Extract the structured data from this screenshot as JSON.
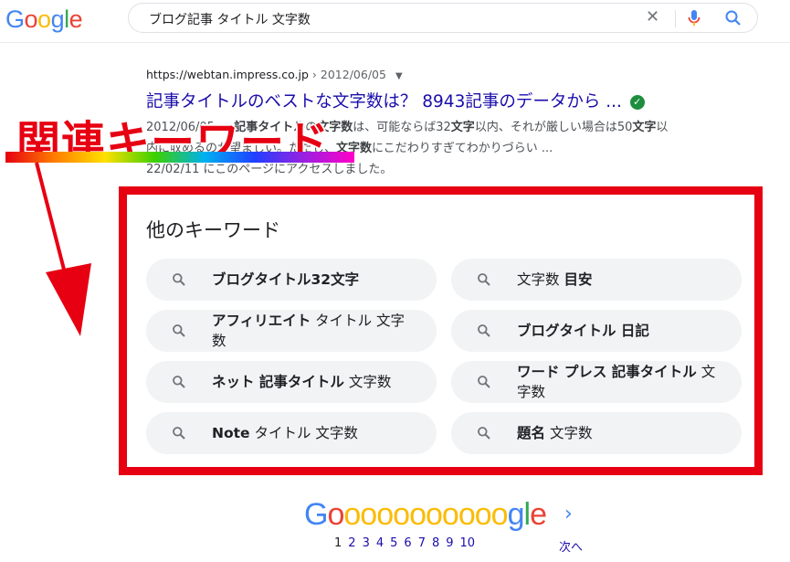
{
  "header": {
    "logo": [
      "G",
      "o",
      "o",
      "g",
      "l",
      "e"
    ],
    "query": "ブログ記事 タイトル 文字数",
    "clear_icon": "close-icon",
    "mic_icon": "mic-icon",
    "search_icon": "search-icon"
  },
  "result": {
    "url": "https://webtan.impress.co.jp",
    "date": "› 2012/06/05",
    "title": "記事タイトルのベストな文字数は？ 8943記事のデータから ...",
    "snippet": [
      {
        "parts": [
          {
            "t": "2012/06/05 — ",
            "b": false
          },
          {
            "t": "記事タイトル",
            "b": true
          },
          {
            "t": "の",
            "b": false
          },
          {
            "t": "文字数",
            "b": true
          },
          {
            "t": "は、可能ならば32",
            "b": false
          },
          {
            "t": "文字",
            "b": true
          },
          {
            "t": "以内、それが厳しい場合は50",
            "b": false
          },
          {
            "t": "文字",
            "b": true
          },
          {
            "t": "以",
            "b": false
          }
        ]
      },
      {
        "parts": [
          {
            "t": "内に収めるのが望ましい。ただし、",
            "b": false
          },
          {
            "t": "文字数",
            "b": true
          },
          {
            "t": "にこだわりすぎてわかりづらい ...",
            "b": false
          }
        ]
      },
      {
        "parts": [
          {
            "t": "22/02/11 にこのページにアクセスしました。",
            "b": false
          }
        ]
      }
    ]
  },
  "annotation": {
    "label": "関連キーワード",
    "colors": {
      "red": "#e60012"
    }
  },
  "related": {
    "heading": "他のキーワード",
    "items": [
      {
        "parts": [
          {
            "t": "ブログタイトル32文字",
            "b": true
          }
        ],
        "two": false
      },
      {
        "parts": [
          {
            "t": "文字数 ",
            "b": false
          },
          {
            "t": "目安",
            "b": true
          }
        ],
        "two": false
      },
      {
        "parts": [
          {
            "t": "アフィリエイト",
            "b": true
          },
          {
            "t": " タイトル 文字数",
            "b": false
          }
        ],
        "two": true
      },
      {
        "parts": [
          {
            "t": "ブログタイトル 日記",
            "b": true
          }
        ],
        "two": false
      },
      {
        "parts": [
          {
            "t": "ネット 記事タイトル",
            "b": true
          },
          {
            "t": " 文字数",
            "b": false
          }
        ],
        "two": false
      },
      {
        "parts": [
          {
            "t": "ワード プレス 記事タイトル",
            "b": true
          },
          {
            "t": " 文字数",
            "b": false
          }
        ],
        "two": true
      },
      {
        "parts": [
          {
            "t": "Note",
            "b": true
          },
          {
            "t": " タイトル 文字数",
            "b": false
          }
        ],
        "two": false
      },
      {
        "parts": [
          {
            "t": "題名",
            "b": true
          },
          {
            "t": " 文字数",
            "b": false
          }
        ],
        "two": false
      }
    ]
  },
  "pagination": {
    "logo_letters": [
      "G",
      "o",
      "o",
      "o",
      "o",
      "o",
      "o",
      "o",
      "o",
      "o",
      "o",
      "o",
      "g",
      "l",
      "e"
    ],
    "pages": [
      "1",
      "2",
      "3",
      "4",
      "5",
      "6",
      "7",
      "8",
      "9",
      "10"
    ],
    "current": "1",
    "next_label": "次へ",
    "next_icon": "chevron-right-icon"
  },
  "colors": {
    "blue": "#4285f4",
    "red": "#ea4335",
    "yellow": "#fbbc05",
    "green": "#34a853",
    "link": "#1a0dab"
  }
}
